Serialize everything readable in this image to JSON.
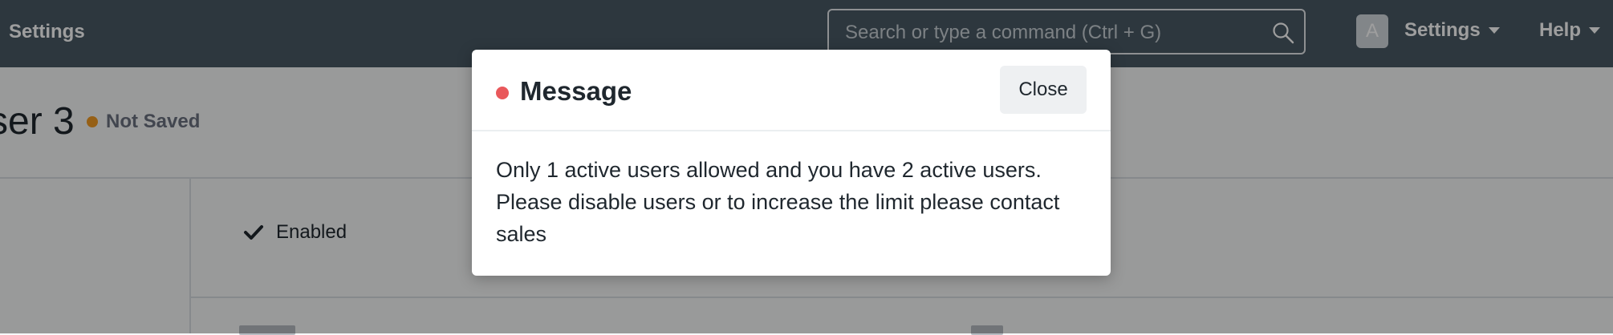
{
  "navbar": {
    "title": "Settings",
    "search": {
      "placeholder": "Search or type a command (Ctrl + G)"
    },
    "avatar_initial": "A",
    "settings_menu": "Settings",
    "help_menu": "Help"
  },
  "page": {
    "title": "ser 3",
    "status": "Not Saved",
    "enabled_label": "Enabled"
  },
  "modal": {
    "title": "Message",
    "close_label": "Close",
    "message": "Only 1 active users allowed and you have 2 active users. Please disable users or to increase the limit please contact sales"
  },
  "colors": {
    "navbar_bg": "#4a5965",
    "indicator_red": "#e9585b",
    "indicator_orange": "#f39c24"
  }
}
